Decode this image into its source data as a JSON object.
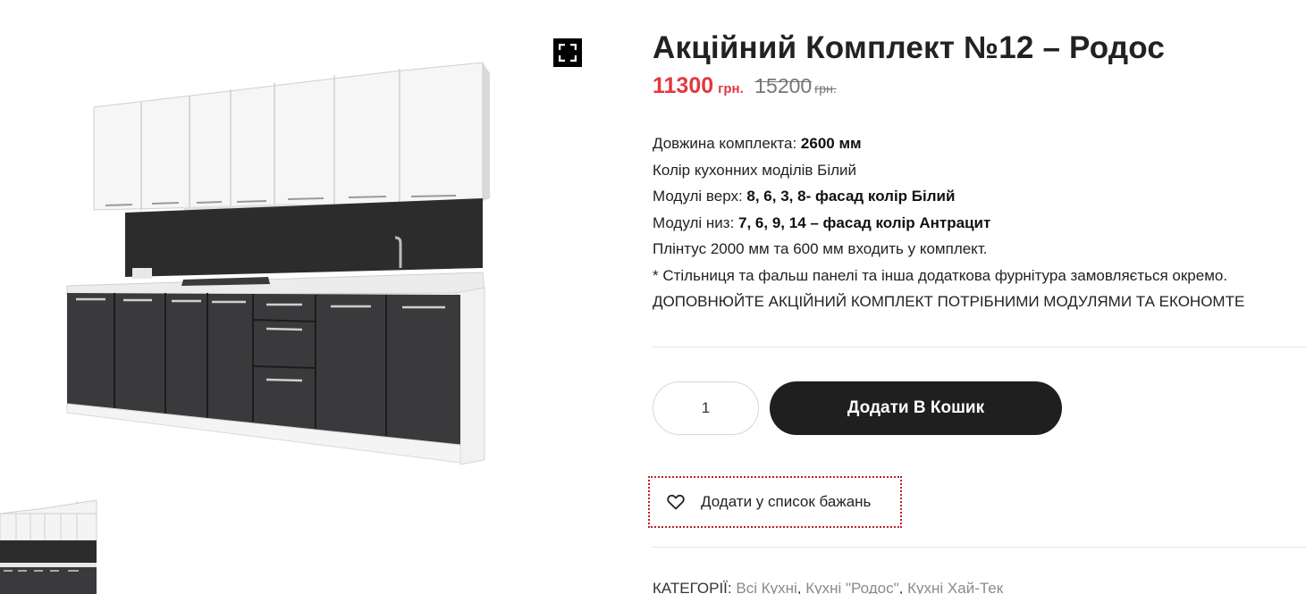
{
  "product": {
    "title": "Акційний Комплект №12 – Родос",
    "price_new": "11300",
    "currency_new": "грн.",
    "price_old": "15200",
    "currency_old": "грн."
  },
  "description": {
    "length_label": "Довжина комплекта: ",
    "length_value": "2600 мм",
    "color_line": "Колір кухонних моділів Білий",
    "top_label": "Модулі верх: ",
    "top_value": "8, 6, 3, 8- фасад колір Білий",
    "bottom_label": "Модулі низ: ",
    "bottom_value": "7, 6, 9, 14 – фасад колір Антрацит",
    "plinth_line": "Плінтус 2000 мм та 600 мм входить у комплект.",
    "note_line": "* Стільниця та фальш панелі та інша додаткова фурнітура замовляється окремо.",
    "promo_line": "ДОПОВНЮЙТЕ АКЦІЙНИЙ КОМПЛЕКТ ПОТРІБНИМИ МОДУЛЯМИ ТА ЕКОНОМТЕ"
  },
  "cart": {
    "quantity": "1",
    "add_label": "Додати В Кошик"
  },
  "wishlist": {
    "label": "Додати у список бажань"
  },
  "meta": {
    "categories_label": "КАТЕГОРІЇ:",
    "categories": [
      "Всі Кухні",
      "Кухні \"Родос\"",
      "Кухні Хай-Тек"
    ]
  },
  "icons": {
    "fullscreen": "fullscreen-icon",
    "wishlist": "heart-icon"
  },
  "colors": {
    "price": "#e2383f",
    "button": "#1f1f1f",
    "wishlist_border": "#c0202b",
    "cabinet_white": "#f4f4f4",
    "cabinet_dark": "#3a3a3c"
  }
}
